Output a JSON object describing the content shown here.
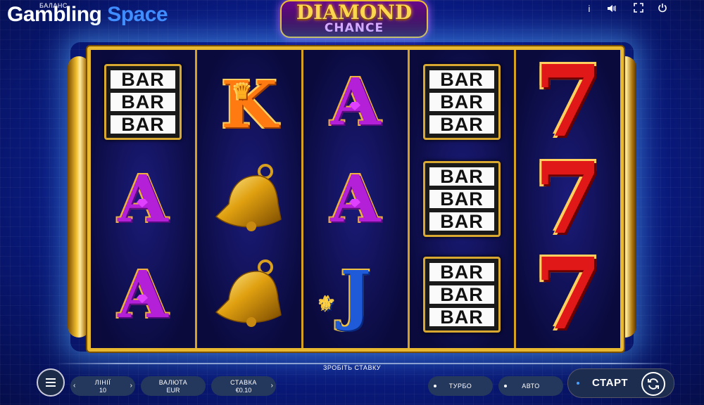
{
  "watermark": {
    "part1": "Gambling",
    "part2": "Space"
  },
  "balance_label": "БАЛАНС",
  "logo": {
    "line1": "DIAMOND",
    "line2": "CHANCE"
  },
  "top_icons": [
    {
      "name": "info-icon",
      "glyph": "i"
    },
    {
      "name": "sound-icon",
      "glyph": "🔈"
    },
    {
      "name": "fullscreen-icon",
      "glyph": "⛶"
    },
    {
      "name": "power-icon",
      "glyph": "⏻"
    }
  ],
  "reels": [
    [
      "bar",
      "letter-a",
      "letter-a"
    ],
    [
      "letter-k",
      "bell",
      "bell"
    ],
    [
      "letter-a",
      "letter-a",
      "letter-j"
    ],
    [
      "bar",
      "bar",
      "bar"
    ],
    [
      "seven",
      "seven",
      "seven"
    ]
  ],
  "symbols": {
    "bar_text": "BAR",
    "letter_a": "A",
    "letter_k": "K",
    "letter_j": "J",
    "seven": "7"
  },
  "controls": {
    "prompt": "ЗРОБІТЬ СТАВКУ",
    "lines": {
      "label": "ЛІНІЇ",
      "value": "10"
    },
    "currency": {
      "label": "ВАЛЮТА",
      "value": "EUR"
    },
    "stake": {
      "label": "СТАВКА",
      "value": "€0.10"
    },
    "turbo": "ТУРБО",
    "auto": "АВТО",
    "start": "СТАРТ"
  },
  "colors": {
    "accent": "#e8b830",
    "background": "#0b1f93"
  }
}
